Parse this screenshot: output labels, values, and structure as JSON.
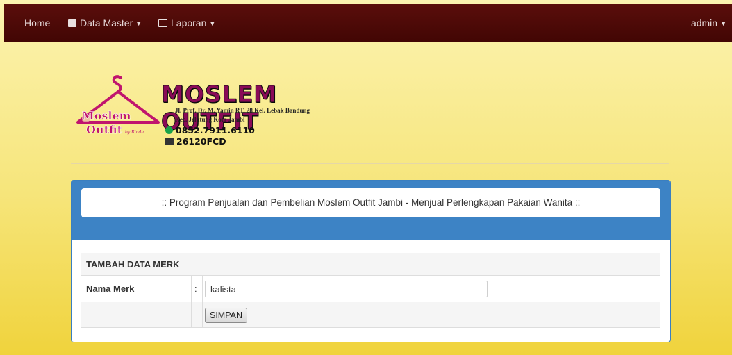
{
  "nav": {
    "home": "Home",
    "data_master": "Data Master",
    "laporan": "Laporan",
    "user": "admin",
    "colors": {
      "bar": "#4a0806",
      "text": "#e6d9d9"
    }
  },
  "logo": {
    "brand": "MOSLEM OUTFIT",
    "emblem_line1": "Moslem",
    "emblem_line2": "Outfit",
    "emblem_tag": "by Rindu",
    "address1": "Jl. Prof. Dr. M. Yamin RT. 28 Kel. Lebak Bandung",
    "address2": "Kec. Jelutung Kota Jambi",
    "phone": "0852.7911.6110",
    "pin": "26120FCD"
  },
  "banner": ":: Program Penjualan dan Pembelian Moslem Outfit Jambi - Menjual Perlengkapan Pakaian Wanita ::",
  "form": {
    "title": "TAMBAH DATA MERK",
    "label_nama": "Nama Merk",
    "colon": ":",
    "nama_value": "kalista",
    "submit": "SIMPAN"
  }
}
